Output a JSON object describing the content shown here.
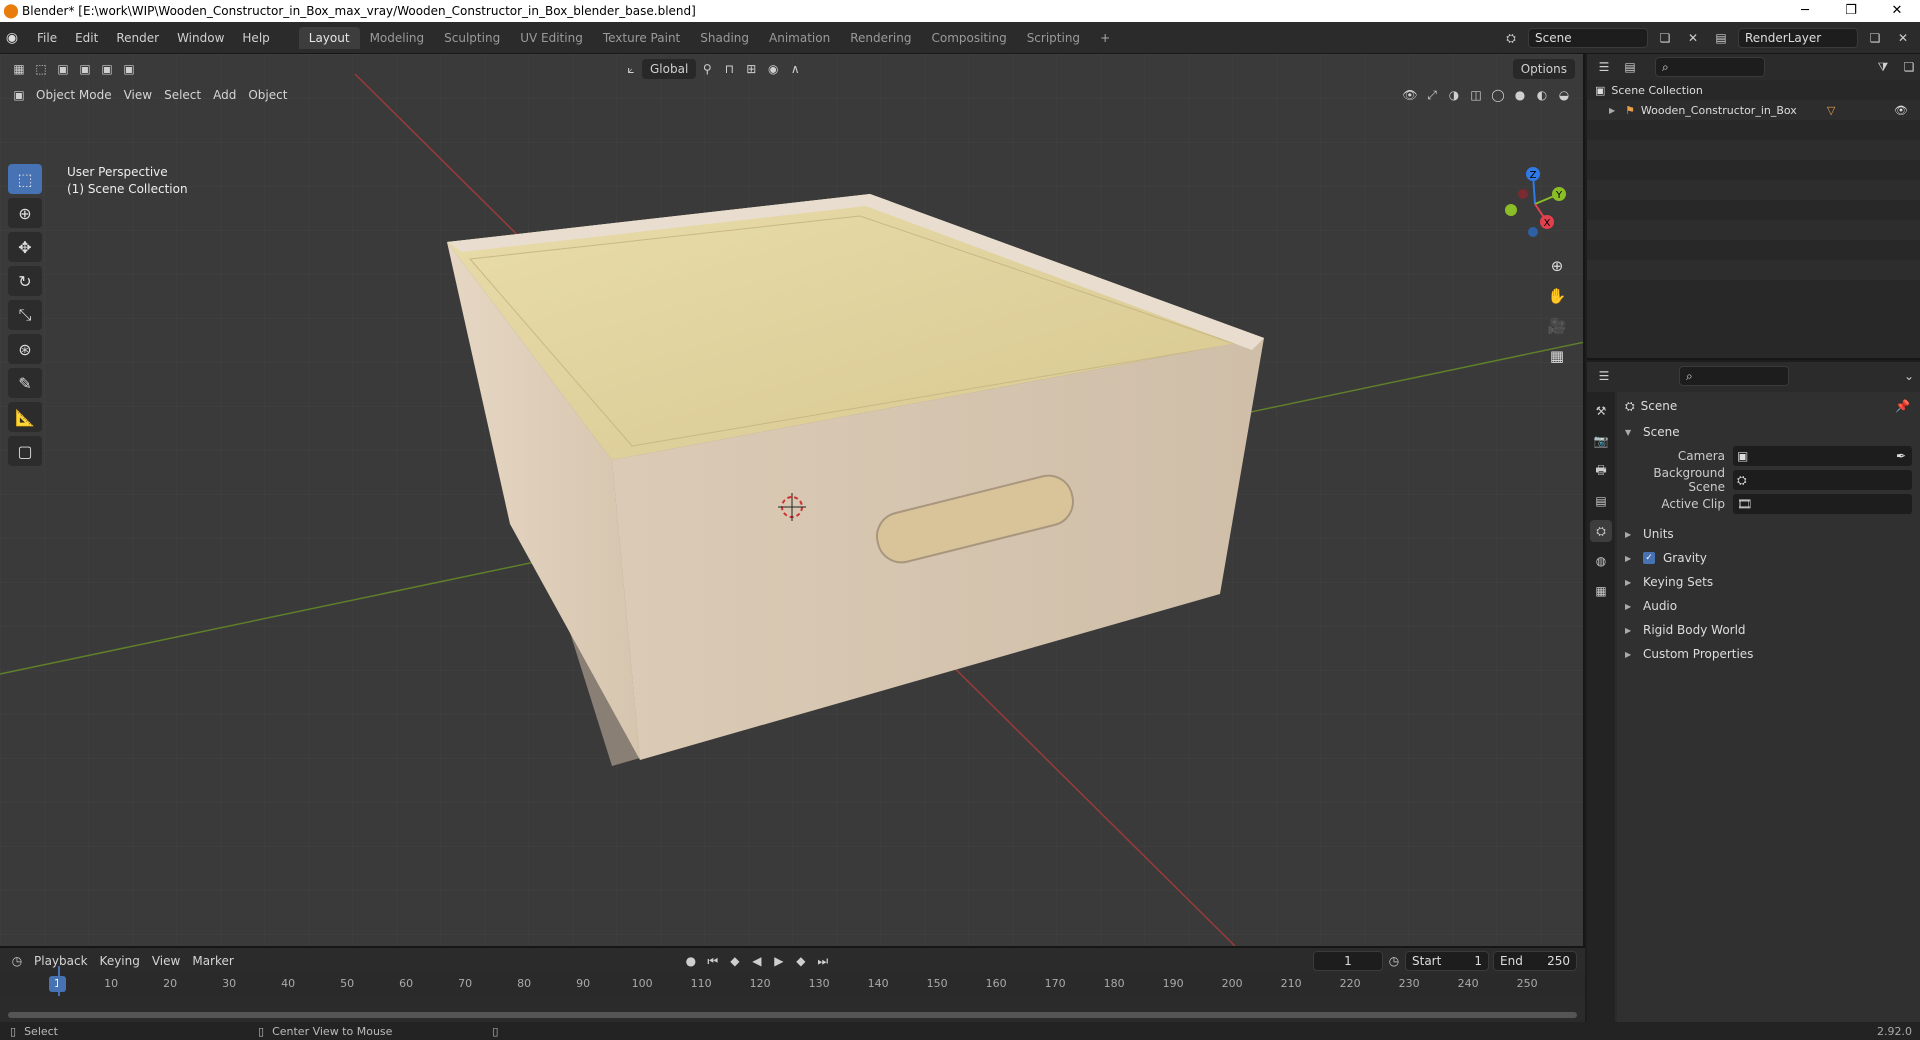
{
  "window": {
    "title": "Blender* [E:\\work\\WIP\\Wooden_Constructor_in_Box_max_vray/Wooden_Constructor_in_Box_blender_base.blend]",
    "min": "─",
    "max": "❐",
    "close": "✕"
  },
  "menu": [
    "File",
    "Edit",
    "Render",
    "Window",
    "Help"
  ],
  "workspace_tabs": [
    {
      "label": "Layout",
      "active": true
    },
    {
      "label": "Modeling"
    },
    {
      "label": "Sculpting"
    },
    {
      "label": "UV Editing"
    },
    {
      "label": "Texture Paint"
    },
    {
      "label": "Shading"
    },
    {
      "label": "Animation"
    },
    {
      "label": "Rendering"
    },
    {
      "label": "Compositing"
    },
    {
      "label": "Scripting"
    }
  ],
  "add_workspace": "+",
  "scene": {
    "name": "Scene",
    "view_layer": "RenderLayer"
  },
  "viewport": {
    "mode": "Object Mode",
    "menus": [
      "View",
      "Select",
      "Add",
      "Object"
    ],
    "transform_orientation": "Global",
    "options": "Options",
    "perspective": "User Perspective",
    "collection": "(1) Scene Collection",
    "gizmo_axes": {
      "x": "X",
      "y": "Y",
      "z": "Z"
    }
  },
  "timeline": {
    "menus": [
      "Playback",
      "Keying",
      "View",
      "Marker"
    ],
    "current_frame": "1",
    "start_label": "Start",
    "start": "1",
    "end_label": "End",
    "end": "250",
    "ticks": [
      "10",
      "20",
      "30",
      "40",
      "50",
      "60",
      "70",
      "80",
      "90",
      "100",
      "110",
      "120",
      "130",
      "140",
      "150",
      "160",
      "170",
      "180",
      "190",
      "200",
      "210",
      "220",
      "230",
      "240",
      "250"
    ]
  },
  "outliner": {
    "root": "Scene Collection",
    "items": [
      "Wooden_Constructor_in_Box"
    ]
  },
  "properties": {
    "context": "Scene",
    "section": "Scene",
    "fields": [
      {
        "label": "Camera",
        "value": ""
      },
      {
        "label": "Background Scene",
        "value": ""
      },
      {
        "label": "Active Clip",
        "value": ""
      }
    ],
    "panels": [
      {
        "label": "Units"
      },
      {
        "label": "Gravity",
        "checked": true
      },
      {
        "label": "Keying Sets"
      },
      {
        "label": "Audio"
      },
      {
        "label": "Rigid Body World"
      },
      {
        "label": "Custom Properties"
      }
    ]
  },
  "status": {
    "left": "Select",
    "middle": "Center View to Mouse",
    "version": "2.92.0"
  },
  "colors": {
    "accent": "#4772b3",
    "x_axis": "#e2404d",
    "y_axis": "#8bbd27",
    "z_axis": "#2f7ae5",
    "wood": "#e6d6c2"
  }
}
